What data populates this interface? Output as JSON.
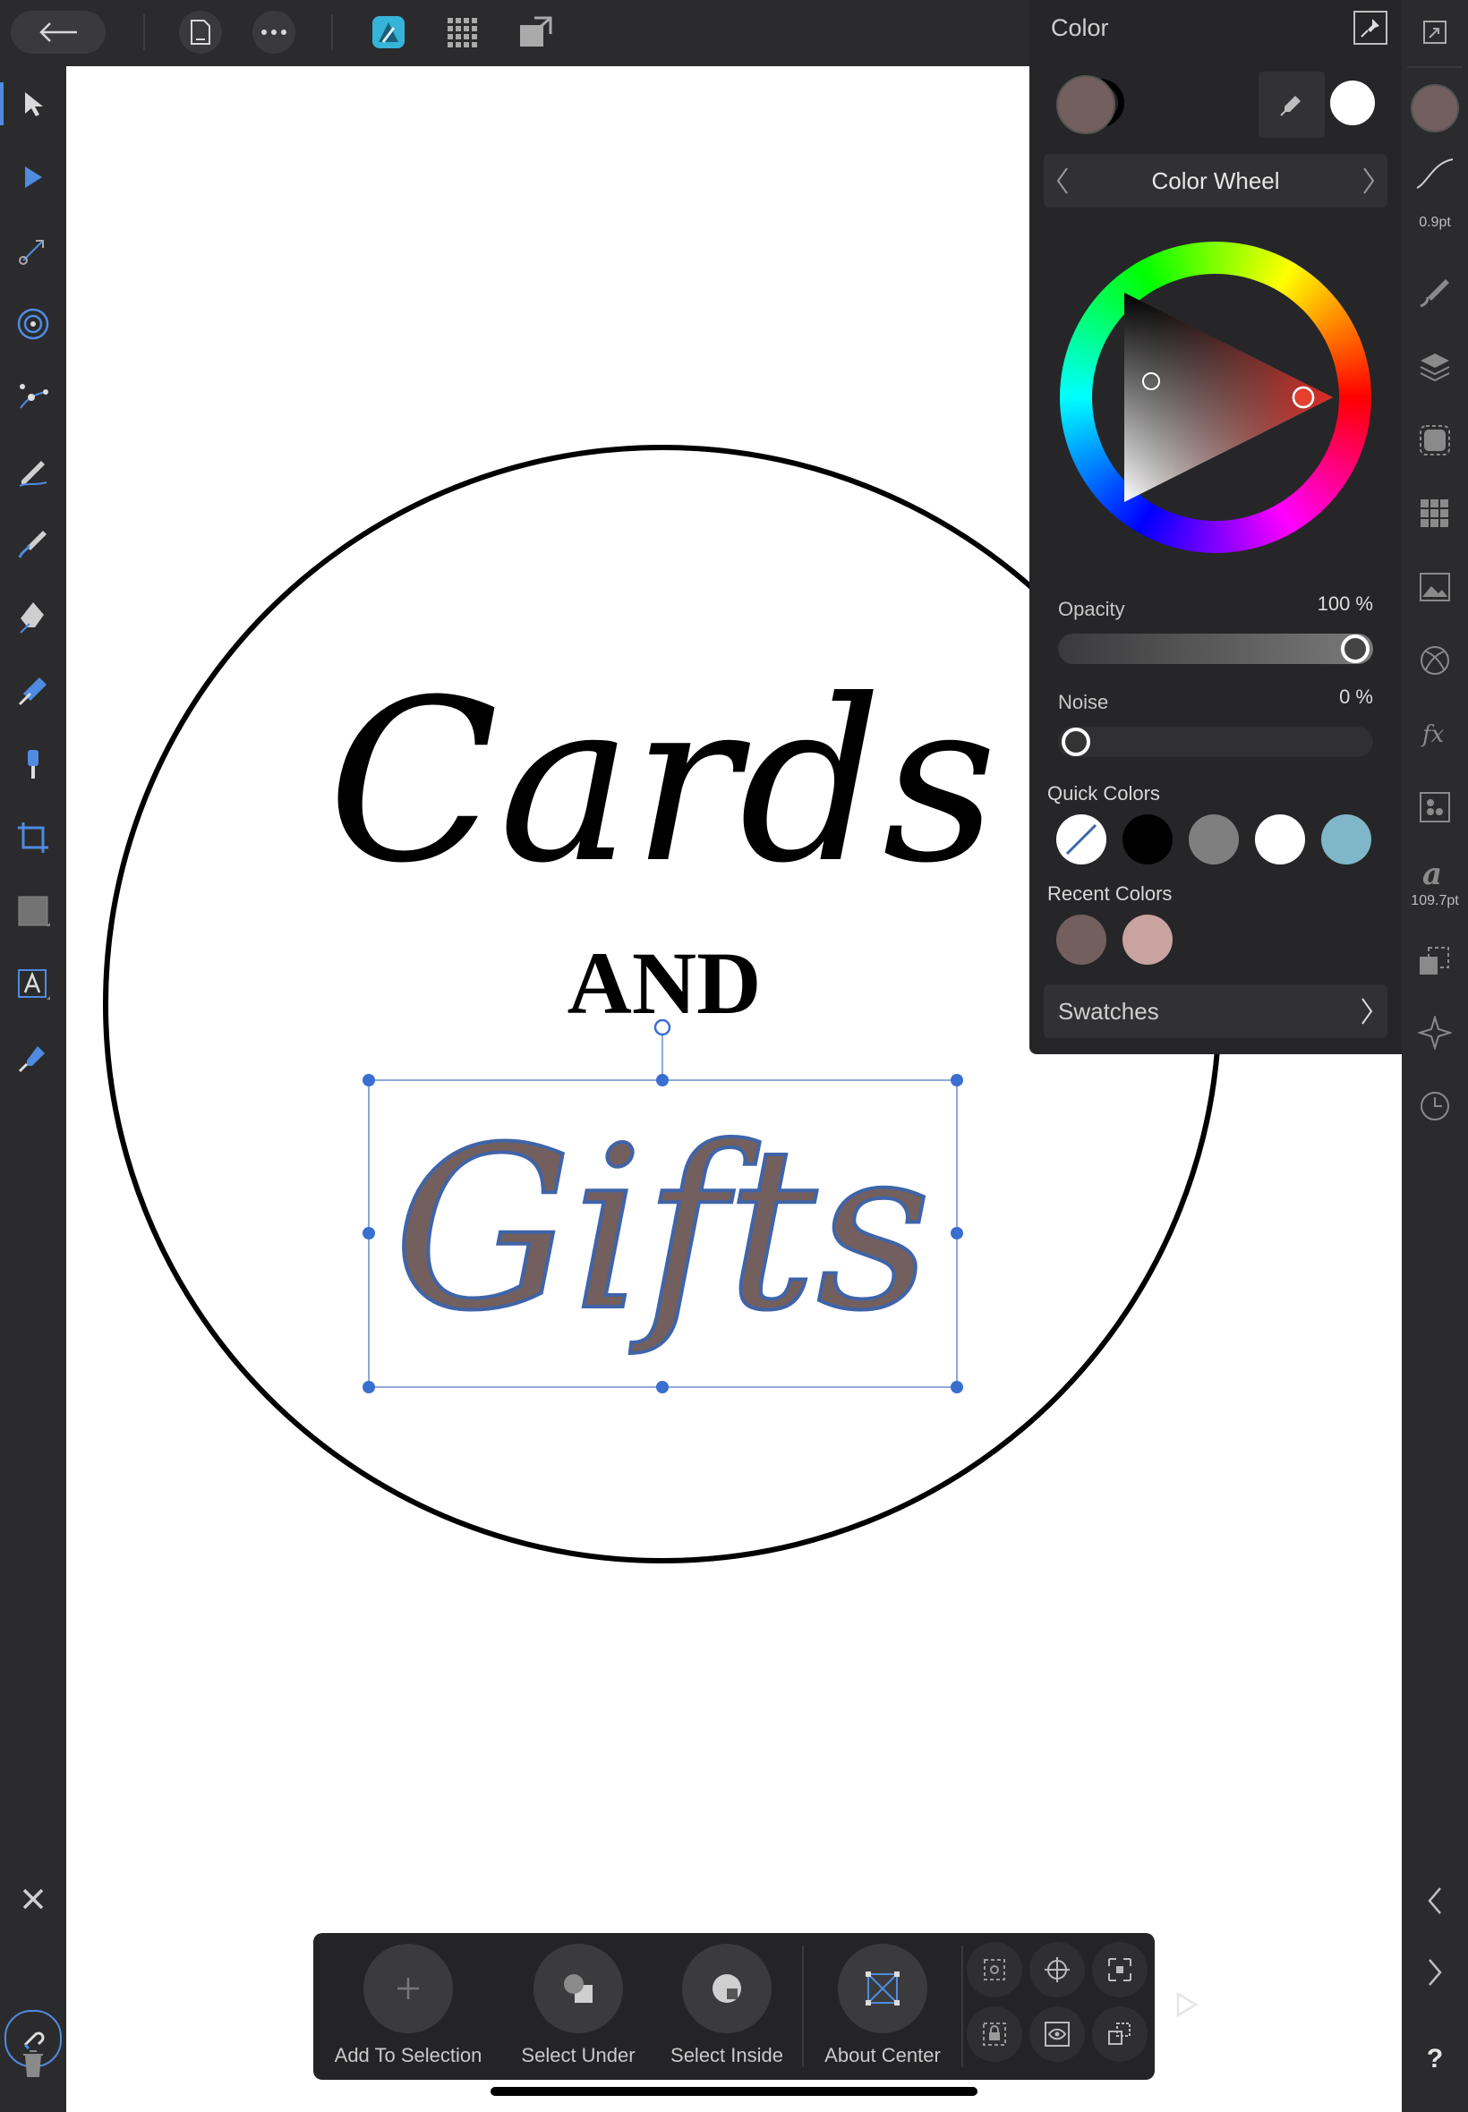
{
  "canvas": {
    "title_word_1": "Cards",
    "title_word_2": "AND",
    "title_word_3": "Gifts",
    "selection_fill": "#735f5d",
    "selection_stroke": "#3f64a8"
  },
  "color_panel": {
    "title": "Color",
    "mode_label": "Color Wheel",
    "opacity_label": "Opacity",
    "opacity_value": "100 %",
    "opacity_level": 1.0,
    "noise_label": "Noise",
    "noise_value": "0 %",
    "noise_level": 0.0,
    "quick_colors_label": "Quick Colors",
    "quick_colors": [
      "none",
      "#000000",
      "#7f7f7f",
      "#ffffff",
      "#7fb7c8"
    ],
    "recent_colors_label": "Recent Colors",
    "recent_colors": [
      "#735f5d",
      "#c9a3a0"
    ],
    "swatches_label": "Swatches",
    "fill_color": "#735f5d",
    "secondary_color": "#ffffff"
  },
  "right_bar": {
    "stroke_width_label": "0.9pt",
    "font_size_label": "109.7pt",
    "help_label": "?"
  },
  "context_toolbar": {
    "add_to_selection": "Add To Selection",
    "select_under": "Select Under",
    "select_inside": "Select Inside",
    "about_center": "About Center"
  }
}
